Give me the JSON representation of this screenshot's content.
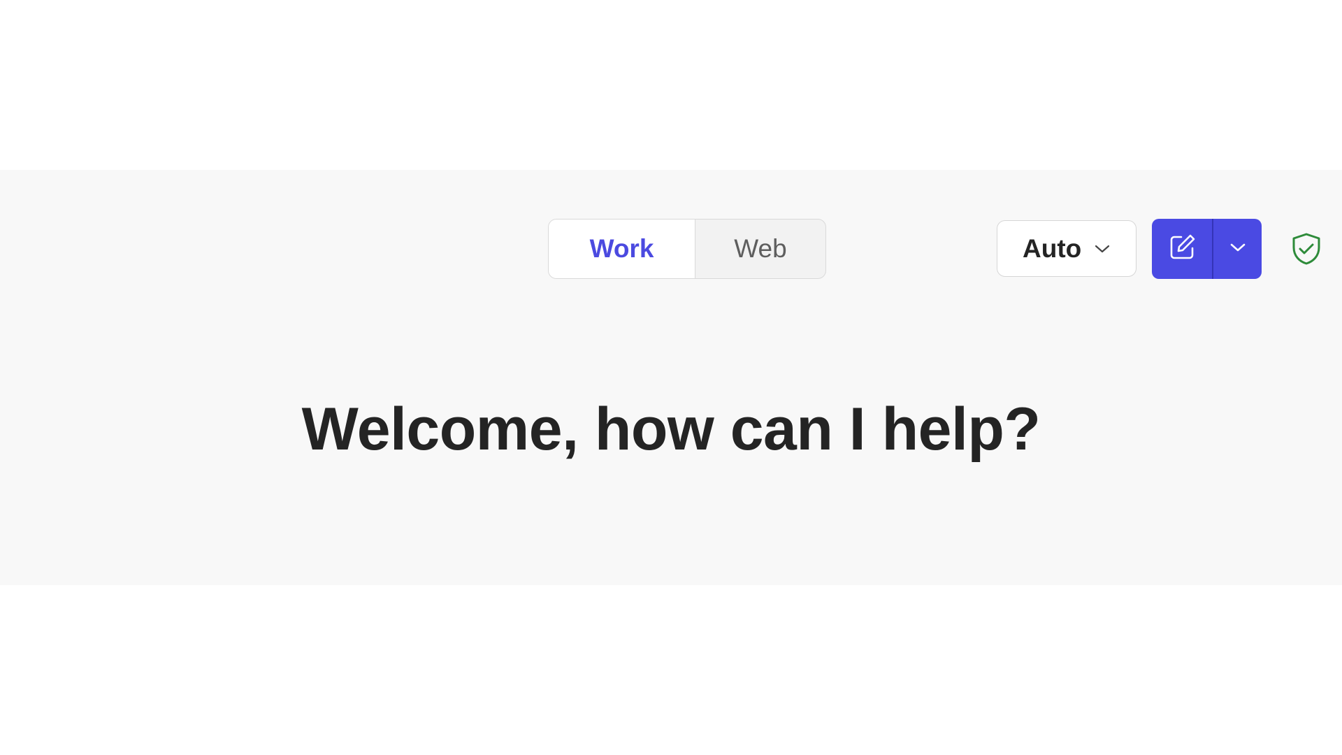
{
  "mode_toggle": {
    "tabs": [
      {
        "label": "Work",
        "selected": true
      },
      {
        "label": "Web",
        "selected": false
      }
    ]
  },
  "model_select": {
    "value": "Auto",
    "icon": "chevron-down-icon"
  },
  "actions": {
    "new_chat_icon": "compose-icon",
    "new_chat_menu_icon": "chevron-down-icon",
    "protection_icon": "shield-check-icon"
  },
  "welcome": {
    "heading": "Welcome, how can I help?"
  },
  "colors": {
    "accent": "#4a4ae3",
    "shield": "#2e8b3a",
    "background_band": "#f8f8f8"
  }
}
